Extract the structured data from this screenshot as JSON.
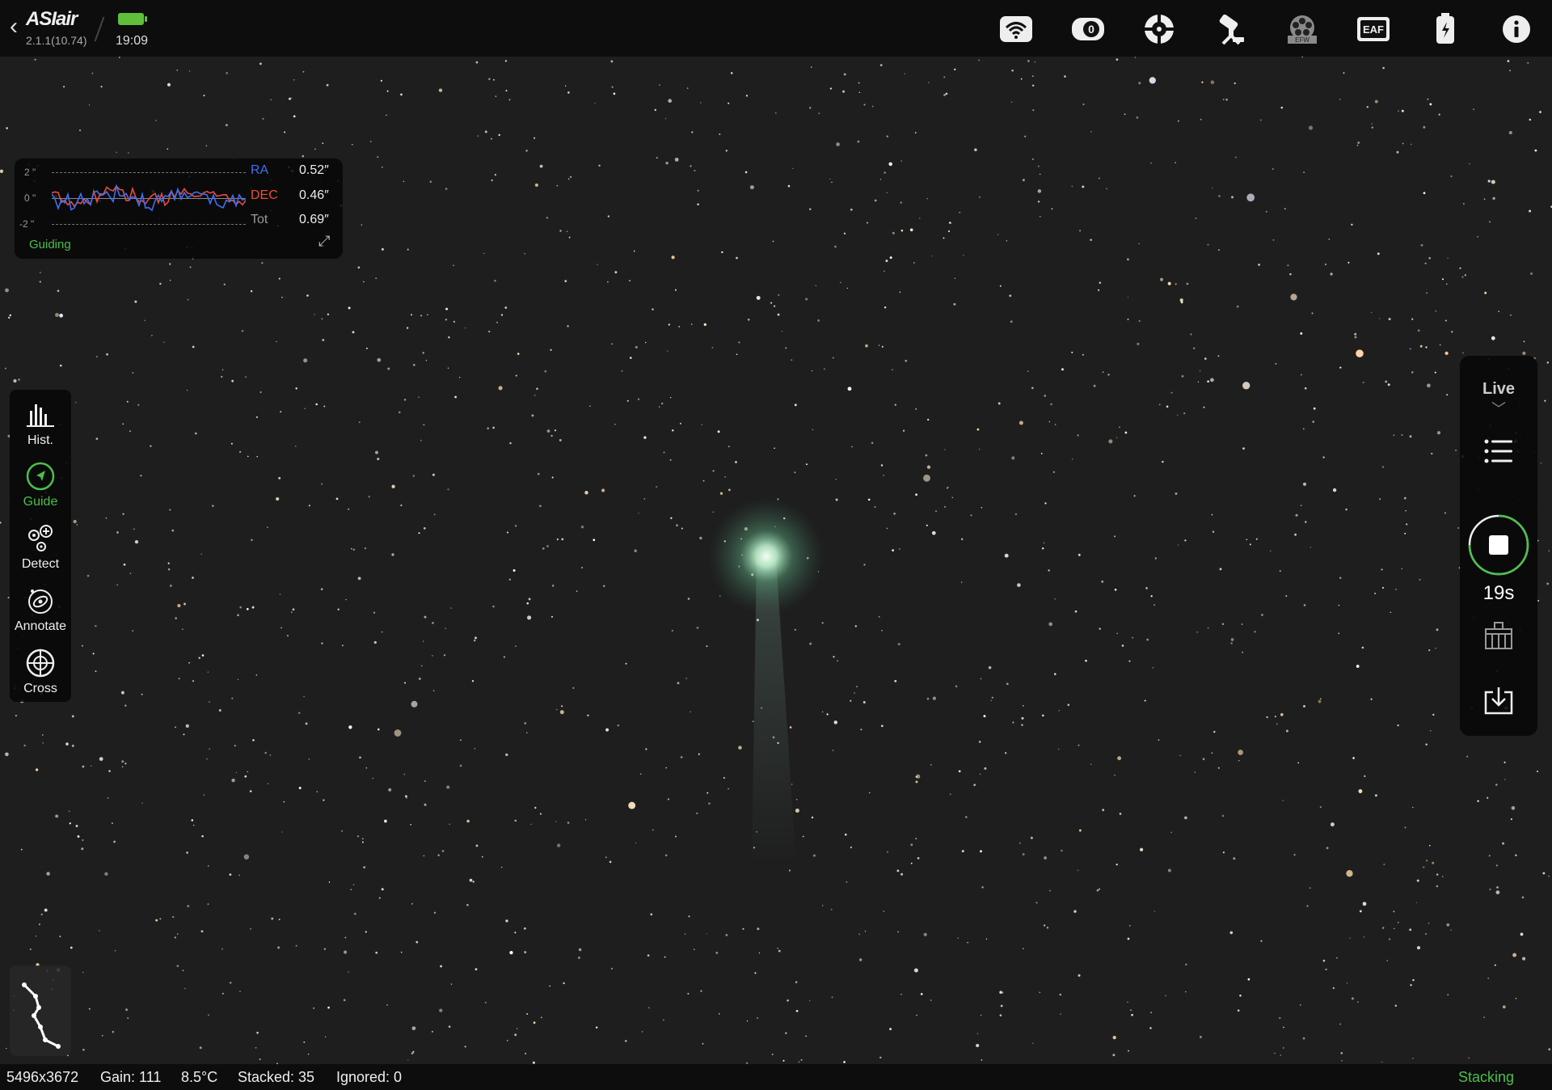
{
  "topbar": {
    "app_name": "ASIair",
    "version": "2.1.1(10.74)",
    "time": "19:09",
    "icons": [
      "back-icon",
      "wifi-icon",
      "camera-icon",
      "guide-camera-icon",
      "mount-icon",
      "efw-icon",
      "eaf-icon",
      "usb-power-icon",
      "info-icon"
    ],
    "efw_label": "EFW",
    "eaf_label": "EAF"
  },
  "guide": {
    "y_labels": [
      "2 \"",
      "0 \"",
      "-2 \""
    ],
    "ra_label": "RA",
    "ra_value": "0.52″",
    "dec_label": "DEC",
    "dec_value": "0.46″",
    "tot_label": "Tot",
    "tot_value": "0.69″",
    "status": "Guiding",
    "colors": {
      "ra": "#3f6ff0",
      "dec": "#e84c3d",
      "status": "#4cbf4c"
    }
  },
  "left_tools": [
    {
      "label": "Hist.",
      "icon": "histogram-icon"
    },
    {
      "label": "Guide",
      "icon": "guide-icon",
      "active": true
    },
    {
      "label": "Detect",
      "icon": "detect-icon"
    },
    {
      "label": "Annotate",
      "icon": "annotate-icon"
    },
    {
      "label": "Cross",
      "icon": "crosshair-icon"
    }
  ],
  "right_panel": {
    "mode": "Live",
    "countdown": "19s",
    "icons": [
      "list-icon",
      "stop-icon",
      "flat-icon",
      "download-icon"
    ]
  },
  "bottom": {
    "resolution": "5496x3672",
    "gain": "Gain: 111",
    "temperature": "8.5°C",
    "stacked": "Stacked: 35",
    "ignored": "Ignored: 0",
    "status": "Stacking"
  }
}
